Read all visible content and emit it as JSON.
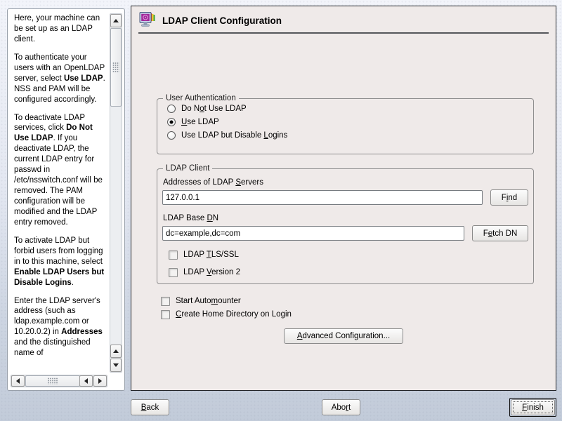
{
  "colors": {
    "page_bg_top": "#f2f4fa",
    "page_bg_bottom": "#c2cbd9",
    "panel_bg": "#efeae9",
    "panel_border": "#222428",
    "help_bg": "#ffffff",
    "icon_screen_purple": "#a0289a",
    "icon_stripe_red": "#cc3322",
    "icon_stripe_yellow": "#e8c820",
    "icon_stripe_green": "#2f9e2f"
  },
  "header": {
    "title": "LDAP Client Configuration",
    "icon": "ldap-computer-icon"
  },
  "help": {
    "paragraphs": [
      [
        {
          "t": "Here, your machine can be set up as an LDAP client.",
          "b": false
        }
      ],
      [
        {
          "t": "To authenticate your users with an OpenLDAP server, select ",
          "b": false
        },
        {
          "t": "Use LDAP",
          "b": true
        },
        {
          "t": ". NSS and PAM will be configured accordingly.",
          "b": false
        }
      ],
      [
        {
          "t": "To deactivate LDAP services, click ",
          "b": false
        },
        {
          "t": "Do Not Use LDAP",
          "b": true
        },
        {
          "t": ". If you deactivate LDAP, the current LDAP entry for passwd in /etc/nsswitch.conf will be removed. The PAM configuration will be modified and the LDAP entry removed.",
          "b": false
        }
      ],
      [
        {
          "t": "To activate LDAP but forbid users from logging in to this machine, select ",
          "b": false
        },
        {
          "t": "Enable LDAP Users but Disable Logins",
          "b": true
        },
        {
          "t": ".",
          "b": false
        }
      ],
      [
        {
          "t": "Enter the LDAP server's address (such as ldap.example.com or 10.20.0.2) in ",
          "b": false
        },
        {
          "t": "Addresses",
          "b": true
        },
        {
          "t": " and the distinguished name of",
          "b": false
        }
      ]
    ]
  },
  "user_auth": {
    "legend": "User Authentication",
    "options": [
      {
        "label": "Do N[o]t Use LDAP",
        "selected": false
      },
      {
        "label": "[U]se LDAP",
        "selected": true
      },
      {
        "label": "Use LDAP but Disable [L]ogins",
        "selected": false
      }
    ]
  },
  "ldap_client": {
    "legend": "LDAP Client",
    "servers_label": "Addresses of LDAP [S]ervers",
    "servers_value": "127.0.0.1",
    "find_button": "F[i]nd",
    "basedn_label": "LDAP Base [D]N",
    "basedn_value": "dc=example,dc=com",
    "fetch_button": "F[e]tch DN",
    "tls_checkbox": {
      "label": "LDAP [T]LS/SSL",
      "checked": false
    },
    "v2_checkbox": {
      "label": "LDAP [V]ersion 2",
      "checked": false
    }
  },
  "extra_options": {
    "automounter_checkbox": {
      "label": "Start Auto[m]ounter",
      "checked": false
    },
    "home_checkbox": {
      "label": "[C]reate Home Directory on Login",
      "checked": false
    },
    "advanced_button": "[A]dvanced Configuration..."
  },
  "footer": {
    "back": "[B]ack",
    "abort": "Abo[r]t",
    "finish": "[F]inish"
  }
}
